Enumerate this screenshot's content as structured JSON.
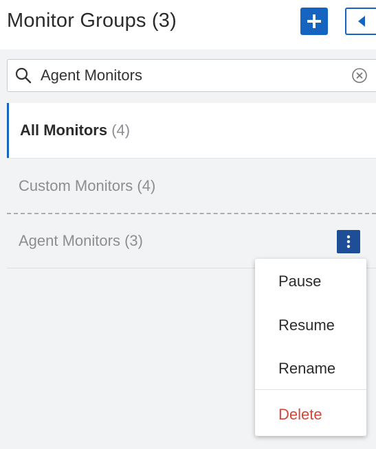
{
  "header": {
    "title": "Monitor Groups (3)",
    "add_icon": "plus-icon",
    "collapse_icon": "triangle-left-icon"
  },
  "search": {
    "value": "Agent Monitors",
    "placeholder": "",
    "search_icon": "magnifier-icon",
    "clear_icon": "circle-x-icon"
  },
  "groups": [
    {
      "name": "All Monitors",
      "count": "(4)",
      "selected": true
    },
    {
      "name": "Custom Monitors",
      "count": "(4)",
      "selected": false
    },
    {
      "name": "Agent Monitors",
      "count": "(3)",
      "selected": false
    }
  ],
  "context_menu": {
    "trigger_icon": "vertical-ellipsis-icon",
    "items": [
      {
        "label": "Pause"
      },
      {
        "label": "Resume"
      },
      {
        "label": "Rename"
      },
      {
        "label": "Delete",
        "danger": true
      }
    ]
  },
  "colors": {
    "accent": "#1565c0",
    "kebab": "#1f4e99",
    "danger": "#d0473b",
    "panel_bg": "#f2f3f4"
  }
}
